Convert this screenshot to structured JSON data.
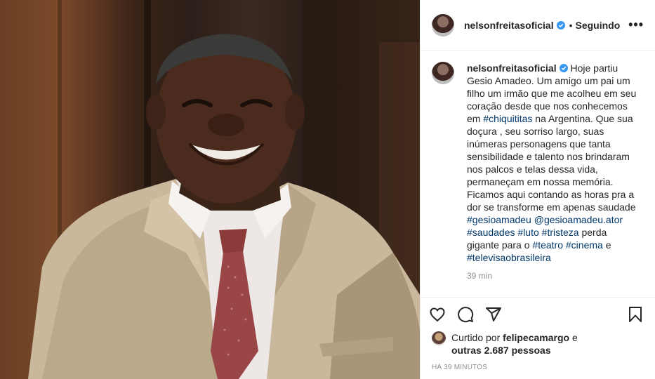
{
  "post": {
    "username": "nelsonfreitasoficial",
    "separator": "•",
    "follow_status": "Seguindo",
    "more_icon": "more-options-icon",
    "verified_icon": "verified-badge-icon"
  },
  "caption": {
    "author": "nelsonfreitasoficial",
    "segments": [
      {
        "t": " Hoje partiu Gesio Amadeo. Um amigo um pai um filho um irmão que me acolheu em seu coração desde que nos conhecemos em ",
        "tag": false
      },
      {
        "t": "#chiquititas",
        "tag": true
      },
      {
        "t": " na Argentina. Que sua doçura , seu sorriso largo, suas inúmeras personagens que tanta sensibilidade e talento nos brindaram nos palcos e telas dessa vida, permaneçam em nossa memória. Ficamos aqui contando as horas pra a dor se transforme em apenas saudade ",
        "tag": false
      },
      {
        "t": "#gesioamadeu",
        "tag": true
      },
      {
        "t": " ",
        "tag": false
      },
      {
        "t": "@gesioamadeu.ator",
        "tag": true
      },
      {
        "t": " ",
        "tag": false
      },
      {
        "t": "#saudades",
        "tag": true
      },
      {
        "t": " ",
        "tag": false
      },
      {
        "t": "#luto",
        "tag": true
      },
      {
        "t": " ",
        "tag": false
      },
      {
        "t": "#tristeza",
        "tag": true
      },
      {
        "t": " perda gigante para o ",
        "tag": false
      },
      {
        "t": "#teatro",
        "tag": true
      },
      {
        "t": " ",
        "tag": false
      },
      {
        "t": "#cinema",
        "tag": true
      },
      {
        "t": " e ",
        "tag": false
      },
      {
        "t": "#televisaobrasileira",
        "tag": true
      }
    ],
    "time": "39 min"
  },
  "actions": {
    "like": "heart-icon",
    "comment": "comment-icon",
    "share": "share-icon",
    "save": "bookmark-icon"
  },
  "likes": {
    "prefix": "Curtido por",
    "user": "felipecamargo",
    "connector": "e",
    "others": "outras 2.687 pessoas"
  },
  "timestamp": "HÁ 39 MINUTOS"
}
